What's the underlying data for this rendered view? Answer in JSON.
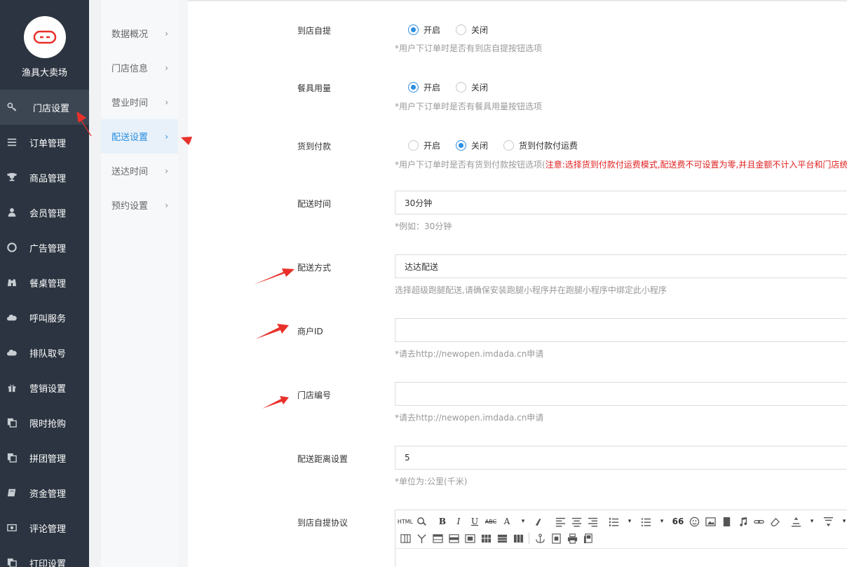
{
  "sidebar": {
    "shop_name": "渔具大卖场",
    "items": [
      {
        "label": "门店设置",
        "icon": "key-icon",
        "active": true
      },
      {
        "label": "订单管理",
        "icon": "list-icon"
      },
      {
        "label": "商品管理",
        "icon": "trophy-icon"
      },
      {
        "label": "会员管理",
        "icon": "user-icon"
      },
      {
        "label": "广告管理",
        "icon": "lifebuoy-icon"
      },
      {
        "label": "餐桌管理",
        "icon": "binoculars-icon"
      },
      {
        "label": "呼叫服务",
        "icon": "cloud-icon"
      },
      {
        "label": "排队取号",
        "icon": "cloud-icon"
      },
      {
        "label": "营销设置",
        "icon": "gift-icon"
      },
      {
        "label": "限时抢购",
        "icon": "copy-icon"
      },
      {
        "label": "拼团管理",
        "icon": "copy-icon"
      },
      {
        "label": "资金管理",
        "icon": "book-icon"
      },
      {
        "label": "评论管理",
        "icon": "money-icon"
      },
      {
        "label": "打印设置",
        "icon": "copy-icon"
      }
    ]
  },
  "subnav": {
    "items": [
      {
        "label": "数据概况"
      },
      {
        "label": "门店信息"
      },
      {
        "label": "营业时间"
      },
      {
        "label": "配送设置",
        "active": true
      },
      {
        "label": "送达时间"
      },
      {
        "label": "预约设置"
      }
    ],
    "chevron": "›"
  },
  "form": {
    "pickup": {
      "label": "到店自提",
      "options": [
        "开启",
        "关闭"
      ],
      "selected": "开启",
      "hint": "*用户下订单时是否有到店自提按钮选项"
    },
    "tableware": {
      "label": "餐具用量",
      "options": [
        "开启",
        "关闭"
      ],
      "selected": "开启",
      "hint": "*用户下订单时是否有餐具用量按钮选项"
    },
    "cod": {
      "label": "货到付款",
      "options": [
        "开启",
        "关闭",
        "货到付款付运费"
      ],
      "selected": "关闭",
      "hint": "*用户下订单时是否有货到付款按钮选项(",
      "hint_warn": "注意:选择货到付款付运费模式,配送费不可设置为零,并且金额不计入平台和门店统计"
    },
    "delivery_time": {
      "label": "配送时间",
      "value": "30分钟",
      "hint": "*例如：30分钟"
    },
    "delivery_method": {
      "label": "配送方式",
      "value": "达达配送",
      "hint": "选择超级跑腿配送,请确保安装跑腿小程序并在跑腿小程序中绑定此小程序"
    },
    "merchant_id": {
      "label": "商户ID",
      "value": "",
      "hint": "*请去http://newopen.imdada.cn申请"
    },
    "store_no": {
      "label": "门店编号",
      "value": "",
      "hint": "*请去http://newopen.imdada.cn申请"
    },
    "distance": {
      "label": "配送距离设置",
      "value": "5",
      "hint": "*单位为:公里(千米)"
    },
    "agreement": {
      "label": "到店自提协议",
      "toolbar_html": "HTML",
      "toolbar_bold": "B",
      "toolbar_italic": "I",
      "toolbar_underline": "U",
      "toolbar_strike": "ABC",
      "toolbar_font": "A",
      "toolbar_quote": "66"
    }
  },
  "colors": {
    "sidebar_bg": "#2b3440",
    "sidebar_active": "#3c4653",
    "accent": "#2b8ee0",
    "warn": "#e02020",
    "annotation_arrow": "#e8302a"
  }
}
